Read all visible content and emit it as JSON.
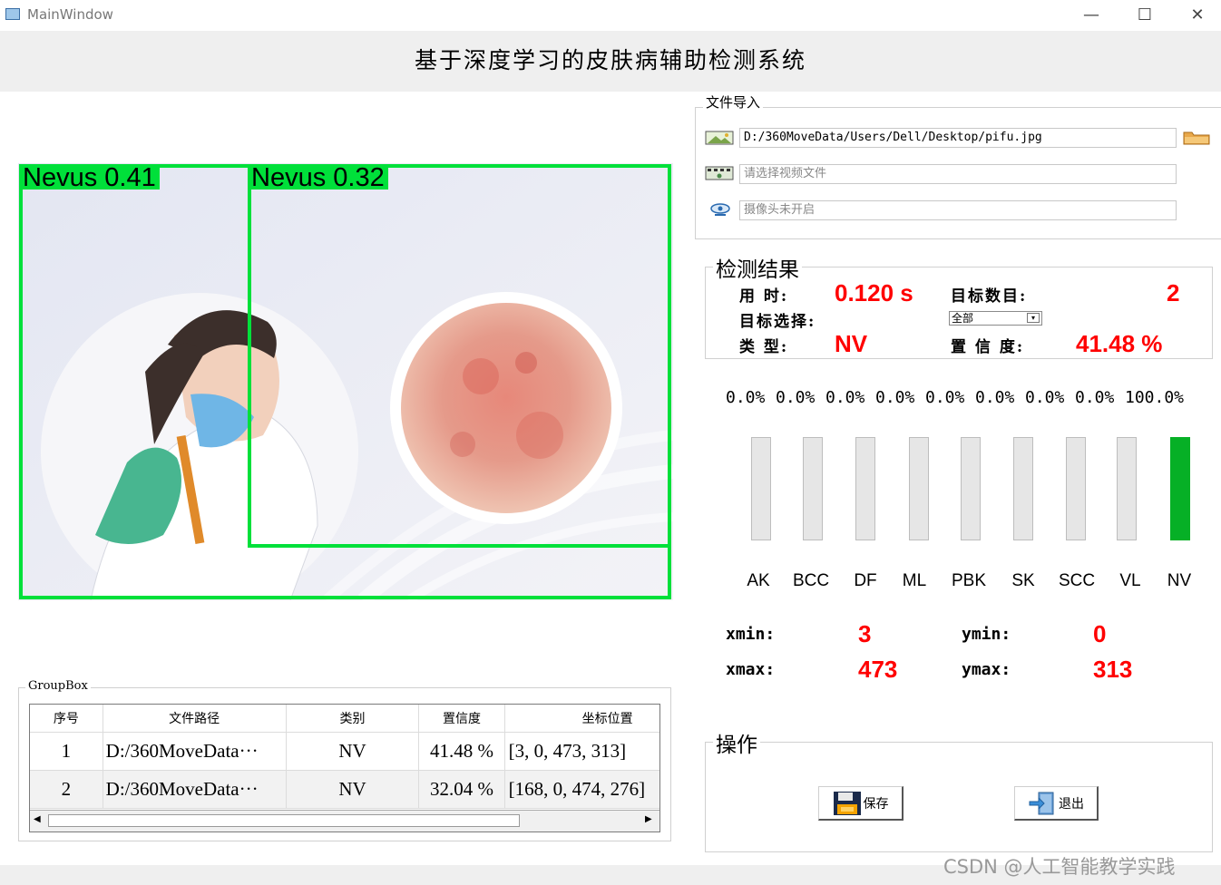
{
  "window": {
    "title": "MainWindow",
    "minimize": "—",
    "maximize": "☐",
    "close": "✕"
  },
  "app": {
    "title": "基于深度学习的皮肤病辅助检测系统"
  },
  "detections_overlay": [
    {
      "label": "Nevus  0.41"
    },
    {
      "label": "Nevus  0.32"
    }
  ],
  "file_import": {
    "title": "文件导入",
    "image_path": "D:/360MoveData/Users/Dell/Desktop/pifu.jpg",
    "video_placeholder": "请选择视频文件",
    "camera_placeholder": "摄像头未开启"
  },
  "result": {
    "title": "检测结果",
    "time_label": "用  时:",
    "time_value": "0.120 s",
    "count_label": "目标数目:",
    "count_value": "2",
    "select_label": "目标选择:",
    "select_value": "全部",
    "type_label": "类  型:",
    "type_value": "NV",
    "conf_label": "置 信 度:",
    "conf_value": "41.48 %"
  },
  "probabilities": [
    {
      "name": "AK",
      "text": "0.0%",
      "value": 0.0
    },
    {
      "name": "BCC",
      "text": "0.0%",
      "value": 0.0
    },
    {
      "name": "DF",
      "text": "0.0%",
      "value": 0.0
    },
    {
      "name": "ML",
      "text": "0.0%",
      "value": 0.0
    },
    {
      "name": "PBK",
      "text": "0.0%",
      "value": 0.0
    },
    {
      "name": "SK",
      "text": "0.0%",
      "value": 0.0
    },
    {
      "name": "SCC",
      "text": "0.0%",
      "value": 0.0
    },
    {
      "name": "VL",
      "text": "0.0%",
      "value": 0.0
    },
    {
      "name": "NV",
      "text": "100.0%",
      "value": 100.0
    }
  ],
  "coords": {
    "xmin_label": "xmin:",
    "xmin": "3",
    "ymin_label": "ymin:",
    "ymin": "0",
    "xmax_label": "xmax:",
    "xmax": "473",
    "ymax_label": "ymax:",
    "ymax": "313"
  },
  "operations": {
    "title": "操作",
    "save": "保存",
    "exit": "退出"
  },
  "table": {
    "group_title": "GroupBox",
    "headers": [
      "序号",
      "文件路径",
      "类别",
      "置信度",
      "坐标位置"
    ],
    "rows": [
      [
        "1",
        "D:/360MoveData···",
        "NV",
        "41.48 %",
        "[3, 0, 473, 313]"
      ],
      [
        "2",
        "D:/360MoveData···",
        "NV",
        "32.04 %",
        "[168, 0, 474, 276]"
      ]
    ]
  },
  "watermark": "CSDN @人工智能教学实践",
  "colors": {
    "box_green": "#00e03a",
    "bar_green": "#06b026",
    "value_red": "#ff0000"
  }
}
